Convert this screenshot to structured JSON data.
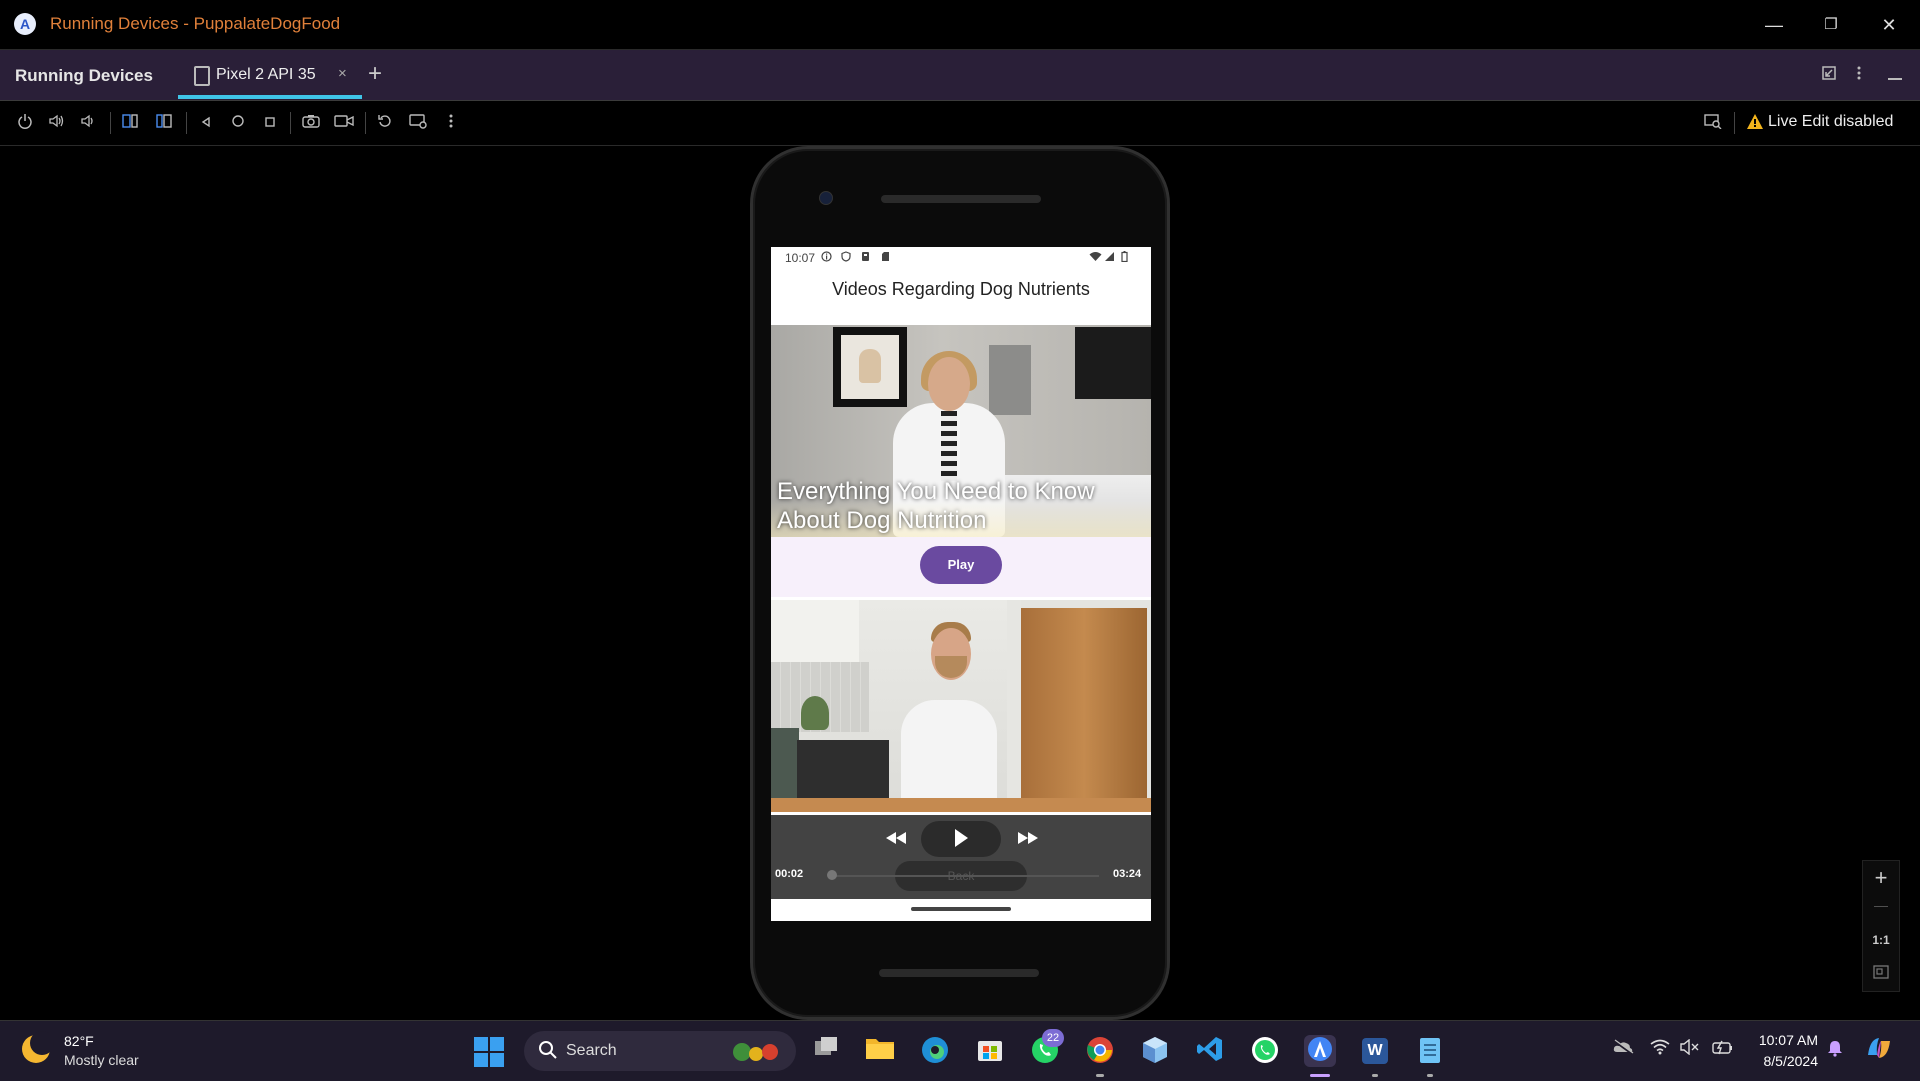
{
  "window": {
    "title": "Running Devices - PuppalateDogFood",
    "logo_glyph": "A",
    "minimize": "—",
    "restore": "❐",
    "close": "✕"
  },
  "tabbar": {
    "panel_title": "Running Devices",
    "tab_label": "Pixel 2 API 35",
    "tab_close": "×",
    "add_tab": "+",
    "accent": "#3fc5e8"
  },
  "toolbar": {
    "live_edit": "Live Edit disabled"
  },
  "device": {
    "status_time": "10:07",
    "app_title": "Videos Regarding Dog Nutrients",
    "video1_caption": "Everything You Need to Know About Dog Nutrition",
    "play_button": "Play",
    "player": {
      "current_time": "00:02",
      "total_time": "03:24",
      "back_label": "Back",
      "progress": 0.01
    }
  },
  "zoom": {
    "zoom_in": "+",
    "zoom_out": "—",
    "actual_size": "1:1"
  },
  "taskbar": {
    "weather_temp": "82°F",
    "weather_desc": "Mostly clear",
    "search_label": "Search",
    "whatsapp_badge": "22",
    "time": "10:07 AM",
    "date": "8/5/2024",
    "word_glyph": "W"
  },
  "colors": {
    "title_text": "#e0803a",
    "tab_bg": "#2a1f38",
    "play_button": "#6a4aa0",
    "taskbar_bg": "#1e1a2b"
  }
}
